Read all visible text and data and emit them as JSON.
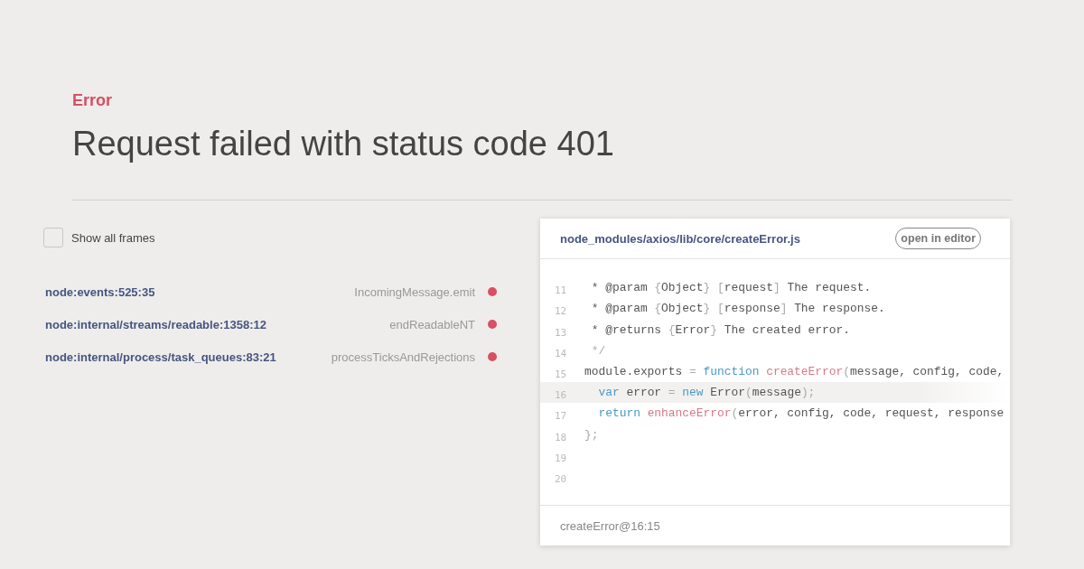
{
  "error": {
    "label": "Error",
    "message": "Request failed with status code 401"
  },
  "frames_toggle": {
    "label": "Show all frames",
    "checked": false
  },
  "frames": [
    {
      "location": "node:events:525:35",
      "method": "IncomingMessage.emit"
    },
    {
      "location": "node:internal/streams/readable:1358:12",
      "method": "endReadableNT"
    },
    {
      "location": "node:internal/process/task_queues:83:21",
      "method": "processTicksAndRejections"
    }
  ],
  "code_panel": {
    "file_path": "node_modules/axios/lib/core/createError.js",
    "open_button": "open in editor",
    "lines": [
      {
        "number": "11",
        "highlighted": false,
        "tokens": [
          {
            "text": " * @param ",
            "kind": "plain"
          },
          {
            "text": "{",
            "kind": "punct"
          },
          {
            "text": "Object",
            "kind": "plain"
          },
          {
            "text": "} [",
            "kind": "punct"
          },
          {
            "text": "request",
            "kind": "plain"
          },
          {
            "text": "]",
            "kind": "punct"
          },
          {
            "text": " The request.",
            "kind": "plain"
          }
        ]
      },
      {
        "number": "12",
        "highlighted": false,
        "tokens": [
          {
            "text": " * @param ",
            "kind": "plain"
          },
          {
            "text": "{",
            "kind": "punct"
          },
          {
            "text": "Object",
            "kind": "plain"
          },
          {
            "text": "} [",
            "kind": "punct"
          },
          {
            "text": "response",
            "kind": "plain"
          },
          {
            "text": "]",
            "kind": "punct"
          },
          {
            "text": " The response.",
            "kind": "plain"
          }
        ]
      },
      {
        "number": "13",
        "highlighted": false,
        "tokens": [
          {
            "text": " * @returns ",
            "kind": "plain"
          },
          {
            "text": "{",
            "kind": "punct"
          },
          {
            "text": "Error",
            "kind": "plain"
          },
          {
            "text": "}",
            "kind": "punct"
          },
          {
            "text": " The created error.",
            "kind": "plain"
          }
        ]
      },
      {
        "number": "14",
        "highlighted": false,
        "tokens": [
          {
            "text": " */",
            "kind": "punct"
          }
        ]
      },
      {
        "number": "15",
        "highlighted": false,
        "tokens": [
          {
            "text": "module.exports ",
            "kind": "plain"
          },
          {
            "text": "= ",
            "kind": "punct"
          },
          {
            "text": "function ",
            "kind": "keyword"
          },
          {
            "text": "createError",
            "kind": "function"
          },
          {
            "text": "(",
            "kind": "punct"
          },
          {
            "text": "message, config, code,",
            "kind": "plain"
          }
        ]
      },
      {
        "number": "16",
        "highlighted": true,
        "tokens": [
          {
            "text": "  var",
            "kind": "keyword"
          },
          {
            "text": " error ",
            "kind": "plain"
          },
          {
            "text": "= ",
            "kind": "punct"
          },
          {
            "text": "new",
            "kind": "keyword"
          },
          {
            "text": " Error",
            "kind": "plain"
          },
          {
            "text": "(",
            "kind": "punct"
          },
          {
            "text": "message",
            "kind": "plain"
          },
          {
            "text": ");",
            "kind": "punct"
          }
        ]
      },
      {
        "number": "17",
        "highlighted": false,
        "tokens": [
          {
            "text": "  return ",
            "kind": "keyword"
          },
          {
            "text": "enhanceError",
            "kind": "function"
          },
          {
            "text": "(",
            "kind": "punct"
          },
          {
            "text": "error, config, code, request, response",
            "kind": "plain"
          }
        ]
      },
      {
        "number": "18",
        "highlighted": false,
        "tokens": [
          {
            "text": "};",
            "kind": "punct"
          }
        ]
      },
      {
        "number": "19",
        "highlighted": false
      },
      {
        "number": "20",
        "highlighted": false
      }
    ],
    "footer": "createError@16:15"
  }
}
